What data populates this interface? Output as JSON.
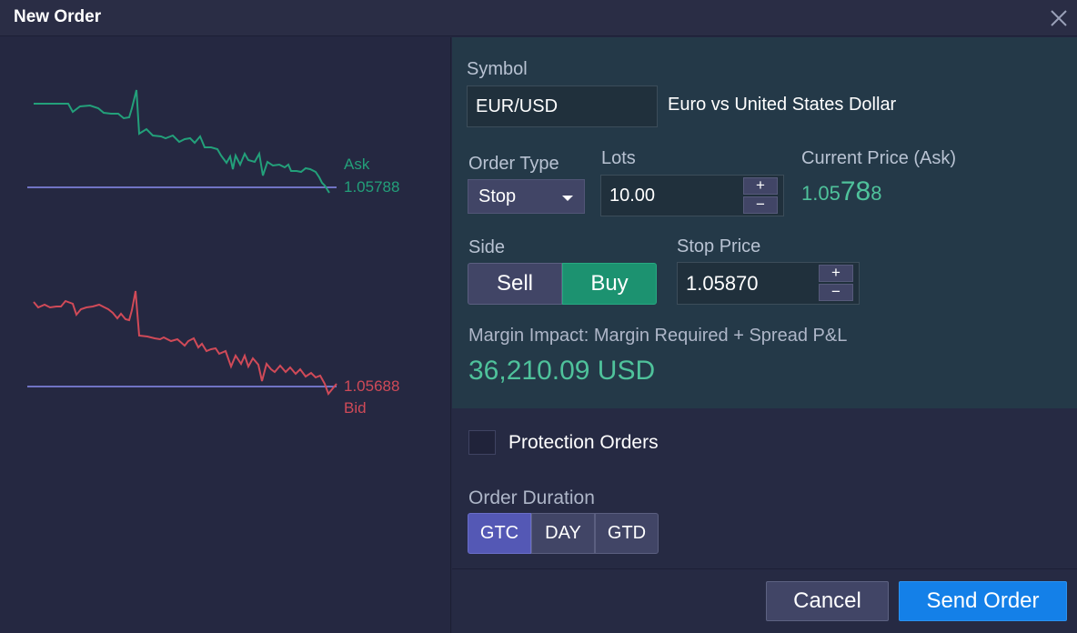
{
  "window": {
    "title": "New Order"
  },
  "chart": {
    "ask_label": "Ask",
    "ask_price": "1.05788",
    "bid_price": "1.05688",
    "bid_label": "Bid",
    "ask_color": "#23a07a",
    "bid_color": "#d04a58",
    "reference_line_color": "#8a8cf0"
  },
  "order": {
    "symbol_label": "Symbol",
    "symbol_value": "EUR/USD",
    "symbol_description": "Euro vs United States Dollar",
    "order_type_label": "Order Type",
    "order_type_value": "Stop",
    "lots_label": "Lots",
    "lots_value": "10.00",
    "current_price_label": "Current Price (Ask)",
    "current_price_parts": {
      "prefix": "1.05",
      "pips": "78",
      "pipette": "8"
    },
    "side_label": "Side",
    "sell_label": "Sell",
    "buy_label": "Buy",
    "stop_price_label": "Stop Price",
    "stop_price_value": "1.05870",
    "stepper_plus": "+",
    "stepper_minus": "−",
    "margin_label": "Margin Impact: Margin Required + Spread P&L",
    "margin_value": "36,210.09 USD"
  },
  "protection": {
    "label": "Protection Orders",
    "checked": false
  },
  "duration": {
    "label": "Order Duration",
    "options": [
      "GTC",
      "DAY",
      "GTD"
    ],
    "selected": "GTC"
  },
  "buttons": {
    "cancel": "Cancel",
    "send": "Send Order"
  },
  "colors": {
    "accent_buy": "#1c9270",
    "accent_send": "#1480e8",
    "price_green": "#4fc29b",
    "duration_active": "#5458b5"
  }
}
